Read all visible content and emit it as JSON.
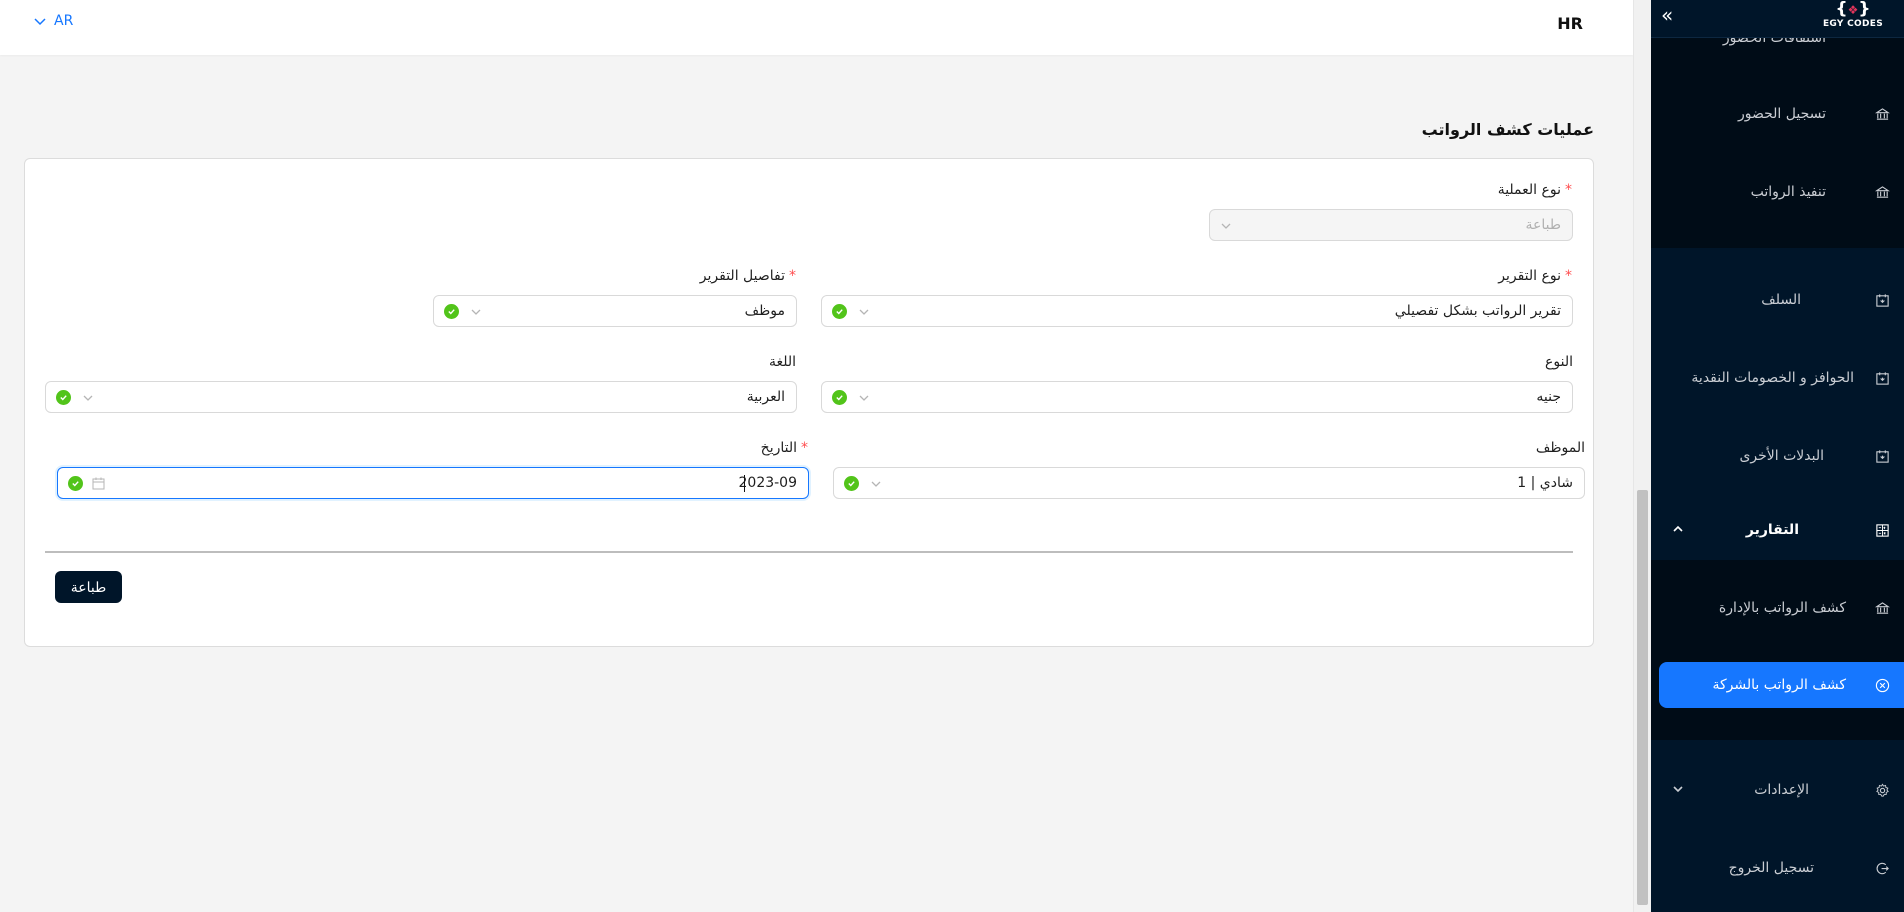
{
  "header": {
    "language": "AR",
    "app_title": "HR"
  },
  "sidebar": {
    "brand_text": "EGY CODES",
    "collapse_glyph": "«",
    "partial_top_label": "اشتقاقات الحضور",
    "items": [
      {
        "label": "تسجيل الحضور",
        "icon": "bank-icon"
      },
      {
        "label": "تنفيذ الرواتب",
        "icon": "bank-icon"
      },
      {
        "label": "السلف",
        "icon": "calendar-icon"
      },
      {
        "label": "الحوافز و الخصومات النقدية",
        "icon": "calendar-icon"
      },
      {
        "label": "البدلات الأخرى",
        "icon": "calendar-icon"
      },
      {
        "label": "التقارير",
        "icon": "calculator-icon"
      },
      {
        "label": "كشف الرواتب بالإدارة",
        "icon": "bank-icon"
      },
      {
        "label": "كشف الرواتب بالشركة",
        "icon": "close-circle-icon"
      },
      {
        "label": "الإعدادات",
        "icon": "gear-icon"
      },
      {
        "label": "تسجيل الخروج",
        "icon": "logout-icon"
      }
    ]
  },
  "page": {
    "title": "عمليات كشف الرواتب"
  },
  "form": {
    "operation_type": {
      "label": "نوع العملية",
      "value": "طباعة"
    },
    "report_type": {
      "label": "نوع التقرير",
      "value": "تقرير الرواتب بشكل تفصيلي"
    },
    "report_details": {
      "label": "تفاصيل التقرير",
      "value": "موظف"
    },
    "type": {
      "label": "النوع",
      "value": "جنيه"
    },
    "language": {
      "label": "اللغة",
      "value": "العربية"
    },
    "employee": {
      "label": "الموظف",
      "value": "شادي | 1"
    },
    "date": {
      "label": "التاريخ",
      "value": "2023-09"
    },
    "required_mark": "*",
    "submit_label": "طباعة"
  },
  "colors": {
    "accent": "#1677ff",
    "sidebar_bg": "#001529",
    "success": "#52c41a",
    "required": "#ff4d4f"
  }
}
